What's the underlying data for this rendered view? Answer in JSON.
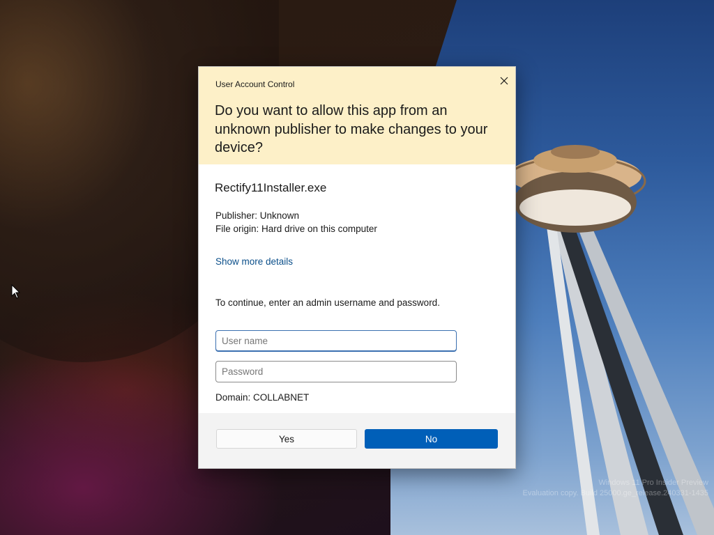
{
  "dialog": {
    "caption": "User Account Control",
    "question": "Do you want to allow this app from an unknown publisher to make changes to your device?",
    "app_name": "Rectify11Installer.exe",
    "publisher": "Publisher: Unknown",
    "file_origin": "File origin: Hard drive on this computer",
    "more_details_link": "Show more details",
    "instruction": "To continue, enter an admin username and password.",
    "username_field": {
      "placeholder": "User name",
      "value": ""
    },
    "password_field": {
      "placeholder": "Password",
      "value": ""
    },
    "domain": "Domain: COLLABNET",
    "yes_label": "Yes",
    "no_label": "No",
    "close_icon": "close-icon"
  },
  "watermark": {
    "line1": "Windows 11 Pro Insider Preview",
    "line2": "Evaluation copy. Build 25000.ge_release.240331-1435"
  },
  "colors": {
    "header_bg": "#fdf0c8",
    "primary_button": "#005fb8",
    "link": "#0b4f8a"
  }
}
